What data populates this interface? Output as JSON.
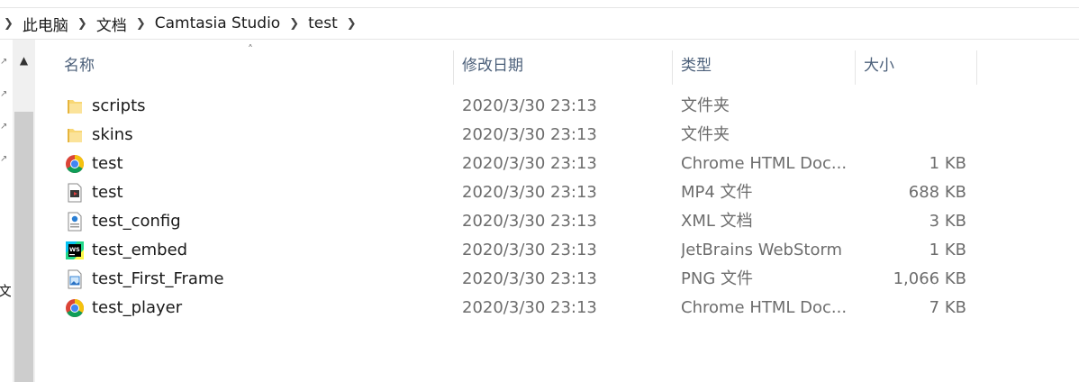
{
  "breadcrumb": {
    "items": [
      "此电脑",
      "文档",
      "Camtasia Studio",
      "test"
    ]
  },
  "left_pane": {
    "clipped_text": "文财"
  },
  "header": {
    "name": "名称",
    "date": "修改日期",
    "type": "类型",
    "size": "大小"
  },
  "files": [
    {
      "name": "scripts",
      "date": "2020/3/30 23:13",
      "type": "文件夹",
      "size": "",
      "icon": "folder-icon"
    },
    {
      "name": "skins",
      "date": "2020/3/30 23:13",
      "type": "文件夹",
      "size": "",
      "icon": "folder-icon"
    },
    {
      "name": "test",
      "date": "2020/3/30 23:13",
      "type": "Chrome HTML Doc...",
      "size": "1 KB",
      "icon": "chrome-icon"
    },
    {
      "name": "test",
      "date": "2020/3/30 23:13",
      "type": "MP4 文件",
      "size": "688 KB",
      "icon": "video-file-icon"
    },
    {
      "name": "test_config",
      "date": "2020/3/30 23:13",
      "type": "XML 文档",
      "size": "3 KB",
      "icon": "xml-file-icon"
    },
    {
      "name": "test_embed",
      "date": "2020/3/30 23:13",
      "type": "JetBrains WebStorm",
      "size": "1 KB",
      "icon": "webstorm-icon"
    },
    {
      "name": "test_First_Frame",
      "date": "2020/3/30 23:13",
      "type": "PNG 文件",
      "size": "1,066 KB",
      "icon": "image-file-icon"
    },
    {
      "name": "test_player",
      "date": "2020/3/30 23:13",
      "type": "Chrome HTML Doc...",
      "size": "7 KB",
      "icon": "chrome-icon"
    }
  ],
  "colors": {
    "header_text": "#4c607a",
    "folder": "#f8d775",
    "chrome_red": "#db4437",
    "chrome_yellow": "#f4c20d",
    "chrome_green": "#0f9d58",
    "chrome_blue": "#4285f4"
  }
}
